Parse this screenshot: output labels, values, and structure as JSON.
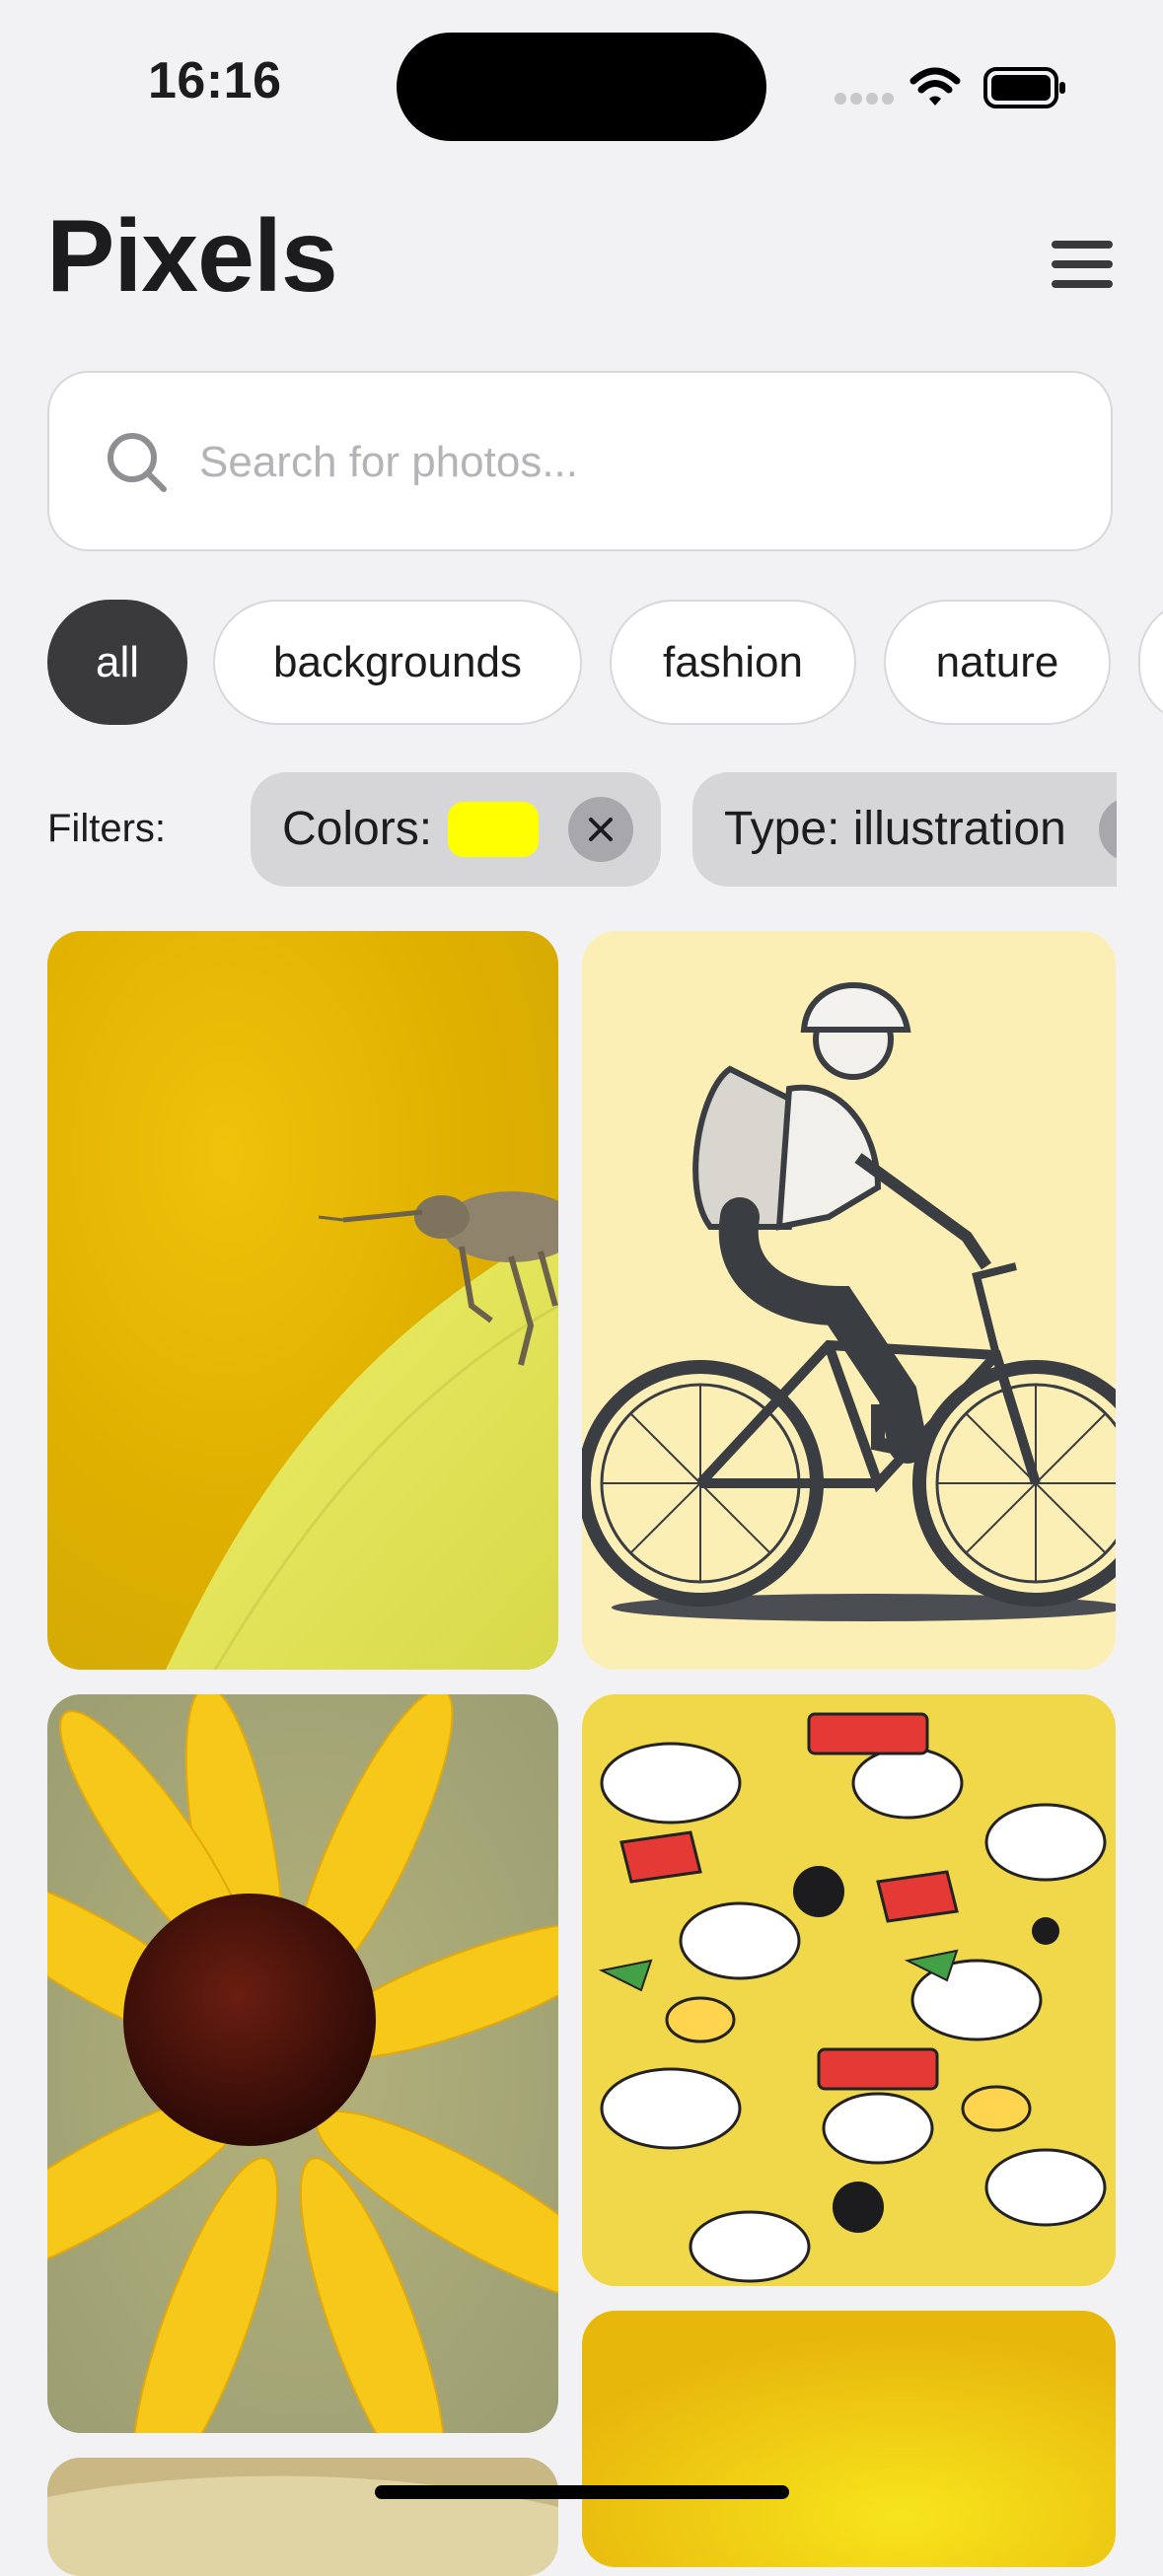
{
  "status_bar": {
    "time": "16:16"
  },
  "header": {
    "title": "Pixels"
  },
  "search": {
    "placeholder": "Search for photos...",
    "value": ""
  },
  "categories": [
    {
      "label": "all",
      "active": true
    },
    {
      "label": "backgrounds",
      "active": false
    },
    {
      "label": "fashion",
      "active": false
    },
    {
      "label": "nature",
      "active": false
    }
  ],
  "filters": {
    "label": "Filters:",
    "items": [
      {
        "label": "Colors:",
        "swatch_color": "#ffff00"
      },
      {
        "label": "Type: illustration"
      }
    ]
  },
  "photos": [
    {
      "icon": "weevil-on-yellow-petal-photo"
    },
    {
      "icon": "cyclist-illustration"
    },
    {
      "icon": "yellow-flower-photo"
    },
    {
      "icon": "comic-pattern-illustration"
    },
    {
      "icon": "yellow-photo-partial"
    },
    {
      "icon": "beige-photo-partial"
    }
  ],
  "colors": {
    "accent_dark": "#3a3a3c",
    "background": "#f2f2f4",
    "filter_pill": "#d6d6d8"
  }
}
